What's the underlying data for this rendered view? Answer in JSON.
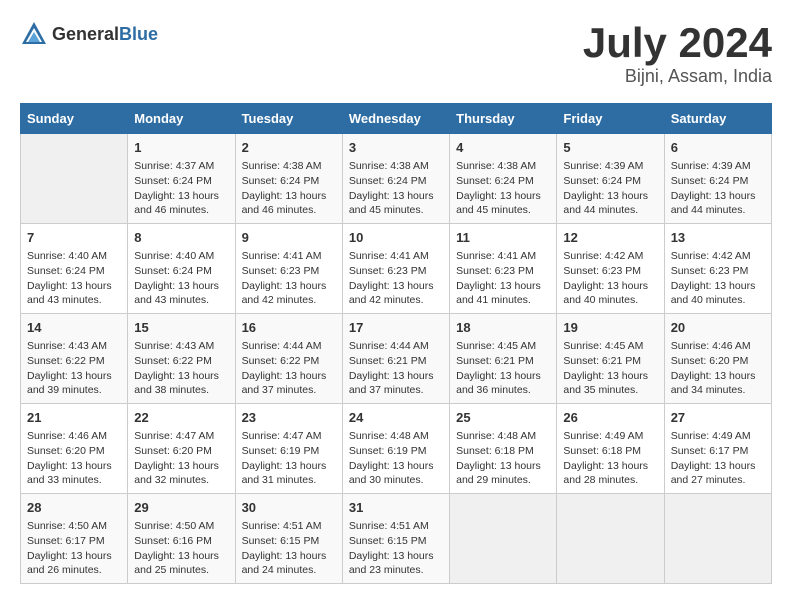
{
  "header": {
    "logo_general": "General",
    "logo_blue": "Blue",
    "title": "July 2024",
    "subtitle": "Bijni, Assam, India"
  },
  "calendar": {
    "days_of_week": [
      "Sunday",
      "Monday",
      "Tuesday",
      "Wednesday",
      "Thursday",
      "Friday",
      "Saturday"
    ],
    "weeks": [
      [
        {
          "day": "",
          "info": ""
        },
        {
          "day": "1",
          "info": "Sunrise: 4:37 AM\nSunset: 6:24 PM\nDaylight: 13 hours\nand 46 minutes."
        },
        {
          "day": "2",
          "info": "Sunrise: 4:38 AM\nSunset: 6:24 PM\nDaylight: 13 hours\nand 46 minutes."
        },
        {
          "day": "3",
          "info": "Sunrise: 4:38 AM\nSunset: 6:24 PM\nDaylight: 13 hours\nand 45 minutes."
        },
        {
          "day": "4",
          "info": "Sunrise: 4:38 AM\nSunset: 6:24 PM\nDaylight: 13 hours\nand 45 minutes."
        },
        {
          "day": "5",
          "info": "Sunrise: 4:39 AM\nSunset: 6:24 PM\nDaylight: 13 hours\nand 44 minutes."
        },
        {
          "day": "6",
          "info": "Sunrise: 4:39 AM\nSunset: 6:24 PM\nDaylight: 13 hours\nand 44 minutes."
        }
      ],
      [
        {
          "day": "7",
          "info": "Sunrise: 4:40 AM\nSunset: 6:24 PM\nDaylight: 13 hours\nand 43 minutes."
        },
        {
          "day": "8",
          "info": "Sunrise: 4:40 AM\nSunset: 6:24 PM\nDaylight: 13 hours\nand 43 minutes."
        },
        {
          "day": "9",
          "info": "Sunrise: 4:41 AM\nSunset: 6:23 PM\nDaylight: 13 hours\nand 42 minutes."
        },
        {
          "day": "10",
          "info": "Sunrise: 4:41 AM\nSunset: 6:23 PM\nDaylight: 13 hours\nand 42 minutes."
        },
        {
          "day": "11",
          "info": "Sunrise: 4:41 AM\nSunset: 6:23 PM\nDaylight: 13 hours\nand 41 minutes."
        },
        {
          "day": "12",
          "info": "Sunrise: 4:42 AM\nSunset: 6:23 PM\nDaylight: 13 hours\nand 40 minutes."
        },
        {
          "day": "13",
          "info": "Sunrise: 4:42 AM\nSunset: 6:23 PM\nDaylight: 13 hours\nand 40 minutes."
        }
      ],
      [
        {
          "day": "14",
          "info": "Sunrise: 4:43 AM\nSunset: 6:22 PM\nDaylight: 13 hours\nand 39 minutes."
        },
        {
          "day": "15",
          "info": "Sunrise: 4:43 AM\nSunset: 6:22 PM\nDaylight: 13 hours\nand 38 minutes."
        },
        {
          "day": "16",
          "info": "Sunrise: 4:44 AM\nSunset: 6:22 PM\nDaylight: 13 hours\nand 37 minutes."
        },
        {
          "day": "17",
          "info": "Sunrise: 4:44 AM\nSunset: 6:21 PM\nDaylight: 13 hours\nand 37 minutes."
        },
        {
          "day": "18",
          "info": "Sunrise: 4:45 AM\nSunset: 6:21 PM\nDaylight: 13 hours\nand 36 minutes."
        },
        {
          "day": "19",
          "info": "Sunrise: 4:45 AM\nSunset: 6:21 PM\nDaylight: 13 hours\nand 35 minutes."
        },
        {
          "day": "20",
          "info": "Sunrise: 4:46 AM\nSunset: 6:20 PM\nDaylight: 13 hours\nand 34 minutes."
        }
      ],
      [
        {
          "day": "21",
          "info": "Sunrise: 4:46 AM\nSunset: 6:20 PM\nDaylight: 13 hours\nand 33 minutes."
        },
        {
          "day": "22",
          "info": "Sunrise: 4:47 AM\nSunset: 6:20 PM\nDaylight: 13 hours\nand 32 minutes."
        },
        {
          "day": "23",
          "info": "Sunrise: 4:47 AM\nSunset: 6:19 PM\nDaylight: 13 hours\nand 31 minutes."
        },
        {
          "day": "24",
          "info": "Sunrise: 4:48 AM\nSunset: 6:19 PM\nDaylight: 13 hours\nand 30 minutes."
        },
        {
          "day": "25",
          "info": "Sunrise: 4:48 AM\nSunset: 6:18 PM\nDaylight: 13 hours\nand 29 minutes."
        },
        {
          "day": "26",
          "info": "Sunrise: 4:49 AM\nSunset: 6:18 PM\nDaylight: 13 hours\nand 28 minutes."
        },
        {
          "day": "27",
          "info": "Sunrise: 4:49 AM\nSunset: 6:17 PM\nDaylight: 13 hours\nand 27 minutes."
        }
      ],
      [
        {
          "day": "28",
          "info": "Sunrise: 4:50 AM\nSunset: 6:17 PM\nDaylight: 13 hours\nand 26 minutes."
        },
        {
          "day": "29",
          "info": "Sunrise: 4:50 AM\nSunset: 6:16 PM\nDaylight: 13 hours\nand 25 minutes."
        },
        {
          "day": "30",
          "info": "Sunrise: 4:51 AM\nSunset: 6:15 PM\nDaylight: 13 hours\nand 24 minutes."
        },
        {
          "day": "31",
          "info": "Sunrise: 4:51 AM\nSunset: 6:15 PM\nDaylight: 13 hours\nand 23 minutes."
        },
        {
          "day": "",
          "info": ""
        },
        {
          "day": "",
          "info": ""
        },
        {
          "day": "",
          "info": ""
        }
      ]
    ]
  }
}
